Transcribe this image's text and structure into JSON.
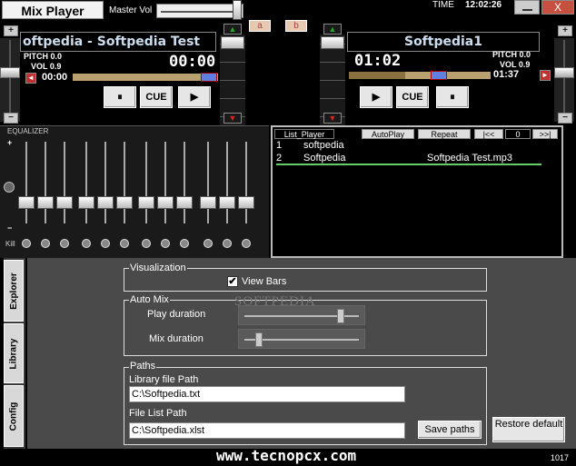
{
  "app": {
    "title": "Mix Player",
    "master_vol_label": "Master Vol",
    "time_label": "TIME",
    "time_value": "12:02:26",
    "close_label": "X",
    "a_label": "a",
    "b_label": "b",
    "master_vol_level": 0.9
  },
  "deck_left": {
    "title": "oftpedia - Softpedia Test",
    "pitch": "PITCH 0.0",
    "vol": "VOL 0.9",
    "elapsed": "00:00",
    "remaining": "00:00",
    "progress": 0.0,
    "pause_label": "⏸",
    "cue_label": "CUE",
    "play_label": "▶",
    "plus": "+",
    "minus": "−",
    "red_btn": "◄"
  },
  "deck_right": {
    "title": "Softpedia1",
    "pitch": "PITCH 0.0",
    "vol": "VOL 0.9",
    "elapsed": "01:02",
    "remaining": "01:37",
    "progress": 0.4,
    "play_label": "▶",
    "cue_label": "CUE",
    "pause_label": "⏸",
    "plus": "+",
    "minus": "−",
    "red_btn": "►"
  },
  "equalizer": {
    "label": "EQUALIZER",
    "kill_label": "Kill",
    "plus": "+",
    "minus": "−"
  },
  "playlist": {
    "header": {
      "list_player": "List_Player",
      "autoplay": "AutoPlay",
      "repeat": "Repeat",
      "prev": "|<<",
      "count": "0",
      "next": ">>|"
    },
    "rows": [
      {
        "num": "1",
        "name": "softpedia",
        "file": ""
      },
      {
        "num": "2",
        "name": "Softpedia",
        "file": "Softpedia Test.mp3"
      }
    ]
  },
  "tabs": {
    "explorer": "Explorer",
    "library": "Library",
    "config": "Config"
  },
  "config": {
    "visualization": {
      "label": "Visualization",
      "view_bars": "View Bars",
      "checked_mark": "✔"
    },
    "automix": {
      "label": "Auto Mix",
      "play_duration": "Play duration",
      "mix_duration": "Mix duration",
      "play_level": 0.85,
      "mix_level": 0.1
    },
    "paths": {
      "label": "Paths",
      "library_label": "Library file Path",
      "library_value": "C:\\Softpedia.txt",
      "filelist_label": "File List Path",
      "filelist_value": "C:\\Softpedia.xlst",
      "save_label": "Save paths"
    },
    "restore_label": "Restore default"
  },
  "watermark": "SOFTPEDIA",
  "website": "www.tecnopcx.com",
  "version": "1017"
}
